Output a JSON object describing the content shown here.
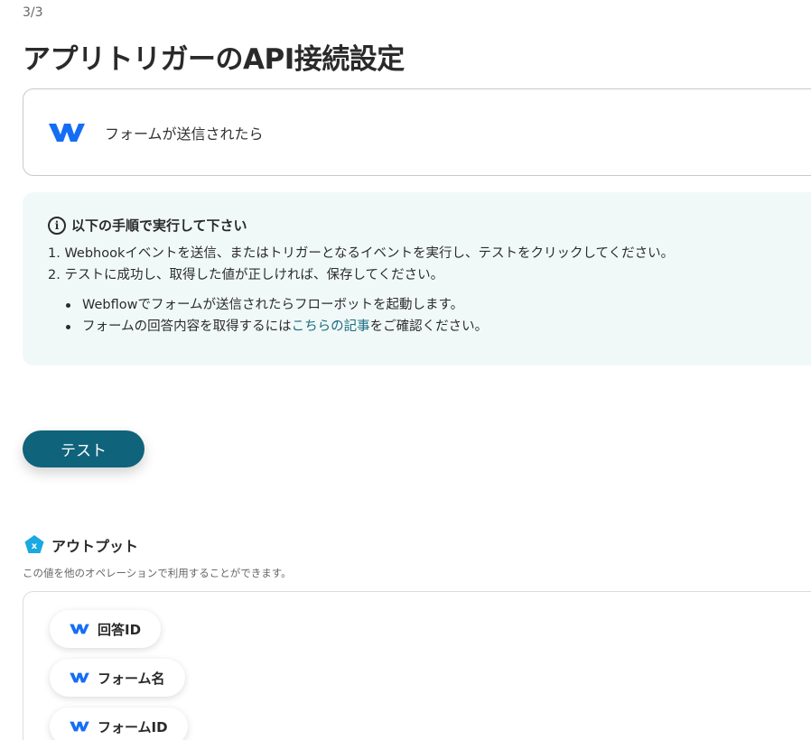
{
  "header": {
    "step": "3/3",
    "title": "アプリトリガーのAPI接続設定"
  },
  "trigger": {
    "icon": "webflow-logo-icon",
    "label": "フォームが送信されたら"
  },
  "instructions": {
    "heading": "以下の手順で実行して下さい",
    "steps": [
      "1. Webhookイベントを送信、またはトリガーとなるイベントを実行し、テストをクリックしてください。",
      "2. テストに成功し、取得した値が正しければ、保存してください。"
    ],
    "bullet1": "Webflowでフォームが送信されたらフローボットを起動します。",
    "bullet2_prefix": "フォームの回答内容を取得するには",
    "bullet2_link": "こちらの記事",
    "bullet2_suffix": "をご確認ください。"
  },
  "test_button": {
    "label": "テスト"
  },
  "output": {
    "title": "アウトプット",
    "description": "この値を他のオペレーションで利用することができます。",
    "items": [
      {
        "label": "回答ID"
      },
      {
        "label": "フォーム名"
      },
      {
        "label": "フォームID"
      }
    ]
  },
  "colors": {
    "accent": "#0f637a",
    "link": "#1a6c80",
    "webflow_blue": "#146ef5",
    "info_bg": "#f1f9f8",
    "output_icon": "#1aa9e0"
  }
}
